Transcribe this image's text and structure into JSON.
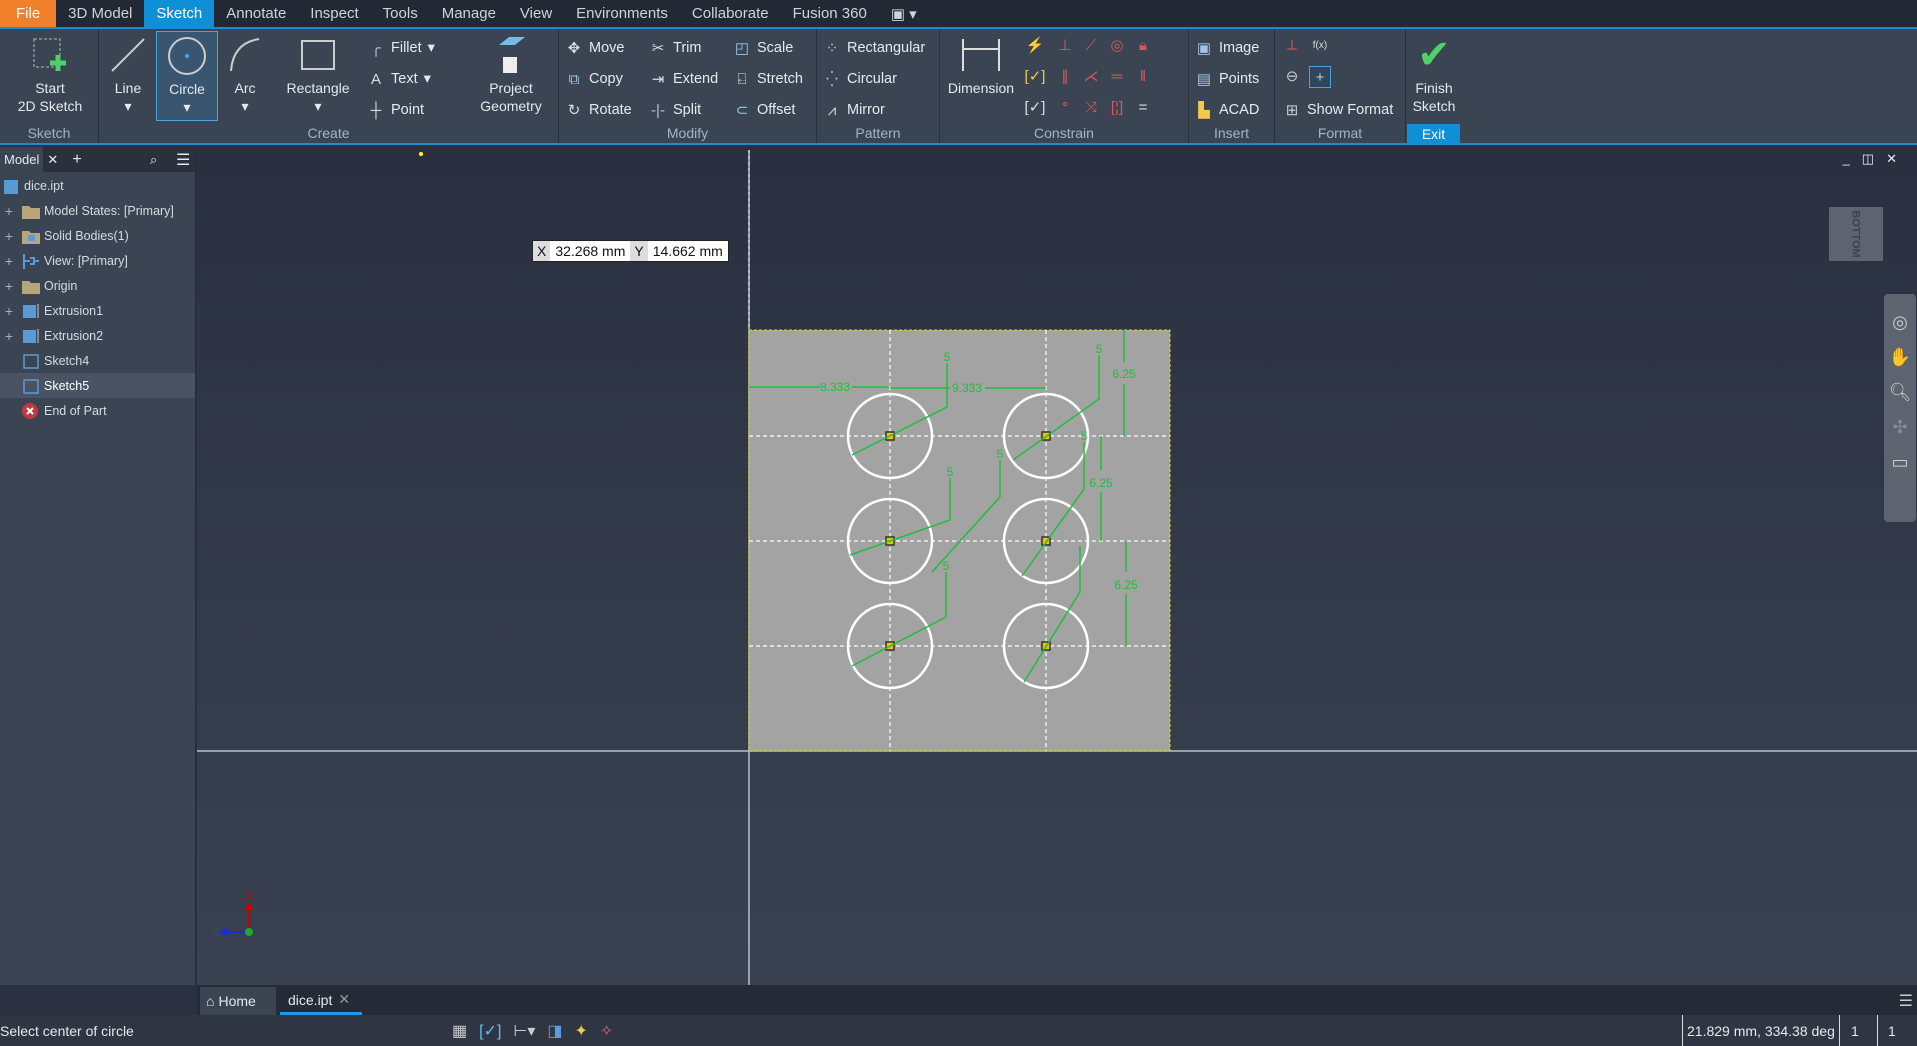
{
  "menu": {
    "tabs": [
      "File",
      "3D Model",
      "Sketch",
      "Annotate",
      "Inspect",
      "Tools",
      "Manage",
      "View",
      "Environments",
      "Collaborate",
      "Fusion 360"
    ],
    "active": "Sketch"
  },
  "ribbon": {
    "panels": {
      "sketch": "Sketch",
      "create": "Create",
      "modify": "Modify",
      "pattern": "Pattern",
      "constrain": "Constrain",
      "insert": "Insert",
      "format": "Format"
    },
    "start_sketch": [
      "Start",
      "2D Sketch"
    ],
    "line": "Line",
    "circle": "Circle",
    "arc": "Arc",
    "rectangle": "Rectangle",
    "fillet": "Fillet",
    "text": "Text",
    "point": "Point",
    "project_geometry": [
      "Project",
      "Geometry"
    ],
    "move": "Move",
    "copy": "Copy",
    "rotate": "Rotate",
    "trim": "Trim",
    "extend": "Extend",
    "split": "Split",
    "scale": "Scale",
    "stretch": "Stretch",
    "offset": "Offset",
    "rectangular": "Rectangular",
    "circular": "Circular",
    "mirror": "Mirror",
    "dimension": "Dimension",
    "image": "Image",
    "points": "Points",
    "acad": "ACAD",
    "show_format": "Show Format",
    "fx_label": "f(x)",
    "finish_sketch": [
      "Finish",
      "Sketch"
    ],
    "exit": "Exit"
  },
  "browser": {
    "tab": "Model",
    "items": [
      {
        "label": "dice.ipt",
        "icon": "part-icon"
      },
      {
        "label": "Model States: [Primary]",
        "icon": "folder-icon"
      },
      {
        "label": "Solid Bodies(1)",
        "icon": "solid-bodies-icon"
      },
      {
        "label": "View: [Primary]",
        "icon": "view-icon"
      },
      {
        "label": "Origin",
        "icon": "folder-icon"
      },
      {
        "label": "Extrusion1",
        "icon": "extrusion-icon"
      },
      {
        "label": "Extrusion2",
        "icon": "extrusion-icon"
      },
      {
        "label": "Sketch4",
        "icon": "sketch-icon"
      },
      {
        "label": "Sketch5",
        "icon": "sketch-icon",
        "selected": true
      },
      {
        "label": "End of Part",
        "icon": "end-of-part-icon"
      }
    ]
  },
  "canvas": {
    "coord_input": {
      "x_label": "X",
      "x_value": "32.268 mm",
      "y_label": "Y",
      "y_value": "14.662 mm"
    },
    "viewcube_face": "BOTTOM",
    "dimensions": {
      "h1": "8.333",
      "h2": "9.333",
      "v1": "6.25",
      "v2": "6.25",
      "v3": "6.25",
      "d1": "5",
      "d2": "5",
      "d3": "5",
      "d4": "5",
      "d5": "5",
      "d6": "5"
    },
    "axes": {
      "x": "X",
      "z": "Z"
    },
    "colors": {
      "sketch_face": "#a3a3a3",
      "dimension": "#1fbf3a",
      "geometry": "#ffffff"
    }
  },
  "doc_tabs": {
    "home": "Home",
    "file": "dice.ipt"
  },
  "status": {
    "prompt": "Select center of circle",
    "readout": "21.829 mm, 334.38 deg",
    "count1": "1",
    "count2": "1"
  }
}
